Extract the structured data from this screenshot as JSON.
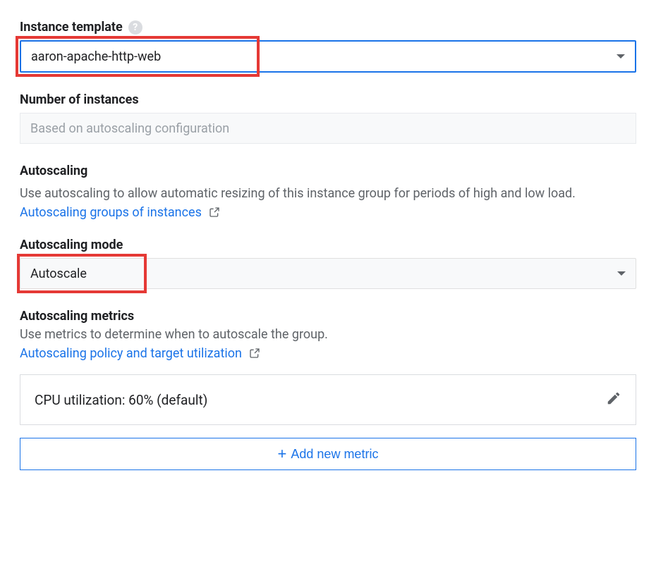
{
  "instance_template": {
    "label": "Instance template",
    "value": "aaron-apache-http-web"
  },
  "num_instances": {
    "label": "Number of instances",
    "placeholder": "Based on autoscaling configuration"
  },
  "autoscaling": {
    "heading": "Autoscaling",
    "desc": "Use autoscaling to allow automatic resizing of this instance group for periods of high and low load. ",
    "link_text": "Autoscaling groups of instances"
  },
  "autoscaling_mode": {
    "label": "Autoscaling mode",
    "value": "Autoscale"
  },
  "autoscaling_metrics": {
    "heading": "Autoscaling metrics",
    "desc": "Use metrics to determine when to autoscale the group.",
    "link_text": "Autoscaling policy and target utilization",
    "metric_card_text": "CPU utilization: 60% (default)",
    "add_button_label": "Add new metric"
  }
}
